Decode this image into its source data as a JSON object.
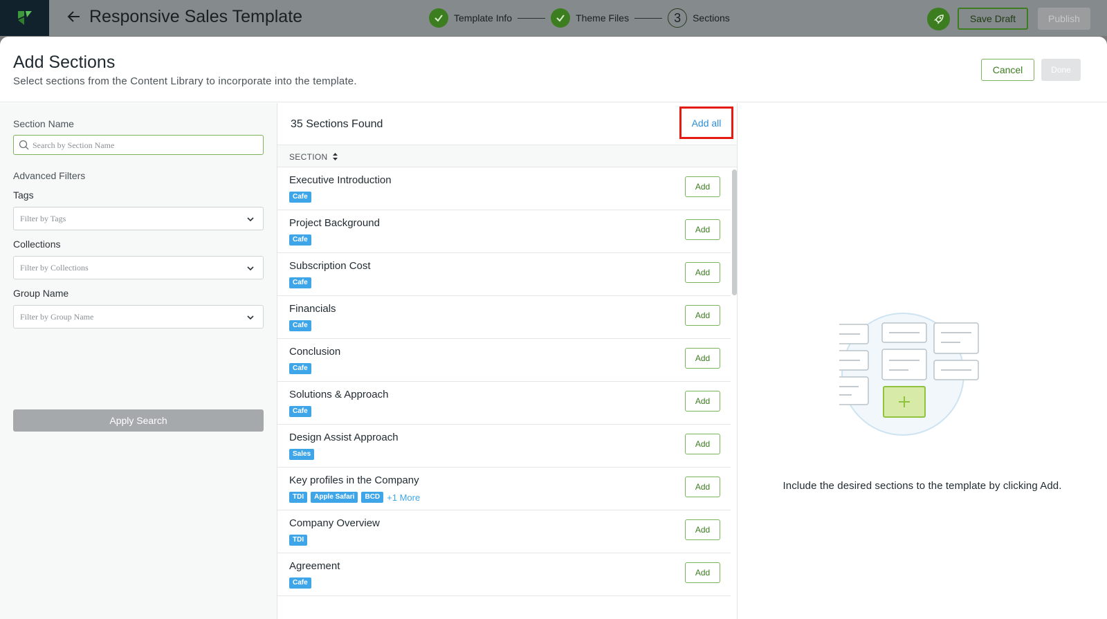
{
  "topbar": {
    "title": "Responsive Sales Template",
    "steps": [
      {
        "label": "Template Info",
        "state": "done"
      },
      {
        "label": "Theme Files",
        "state": "done"
      },
      {
        "label": "Sections",
        "state": "current",
        "number": "3"
      }
    ],
    "save_draft": "Save Draft",
    "publish": "Publish"
  },
  "modal": {
    "title": "Add Sections",
    "subtitle": "Select sections from the Content Library to incorporate into the template.",
    "cancel": "Cancel",
    "done": "Done"
  },
  "filters": {
    "section_name_label": "Section Name",
    "search_placeholder": "Search by Section Name",
    "advanced_label": "Advanced Filters",
    "tags_label": "Tags",
    "tags_placeholder": "Filter by Tags",
    "collections_label": "Collections",
    "collections_placeholder": "Filter by Collections",
    "group_label": "Group Name",
    "group_placeholder": "Filter by Group Name",
    "apply": "Apply Search"
  },
  "list": {
    "found": "35 Sections Found",
    "add_all": "Add all",
    "column_header": "SECTION",
    "add_label": "Add",
    "rows": [
      {
        "name": "Executive Introduction",
        "tags": [
          "Cafe"
        ],
        "more": ""
      },
      {
        "name": "Project Background",
        "tags": [
          "Cafe"
        ],
        "more": ""
      },
      {
        "name": "Subscription Cost",
        "tags": [
          "Cafe"
        ],
        "more": ""
      },
      {
        "name": "Financials",
        "tags": [
          "Cafe"
        ],
        "more": ""
      },
      {
        "name": "Conclusion",
        "tags": [
          "Cafe"
        ],
        "more": ""
      },
      {
        "name": "Solutions & Approach",
        "tags": [
          "Cafe"
        ],
        "more": ""
      },
      {
        "name": "Design Assist Approach",
        "tags": [
          "Sales"
        ],
        "more": ""
      },
      {
        "name": "Key profiles in the Company",
        "tags": [
          "TDI",
          "Apple Safari",
          "BCD"
        ],
        "more": "+1 More"
      },
      {
        "name": "Company Overview",
        "tags": [
          "TDI"
        ],
        "more": ""
      },
      {
        "name": "Agreement",
        "tags": [
          "Cafe"
        ],
        "more": ""
      }
    ]
  },
  "empty_state": {
    "message": "Include the desired sections to the template by clicking Add."
  },
  "colors": {
    "brand_green": "#3c7d1f",
    "tag_blue": "#3ea6e8",
    "link_blue": "#2c8fd8",
    "highlight_red": "#e41b13"
  }
}
